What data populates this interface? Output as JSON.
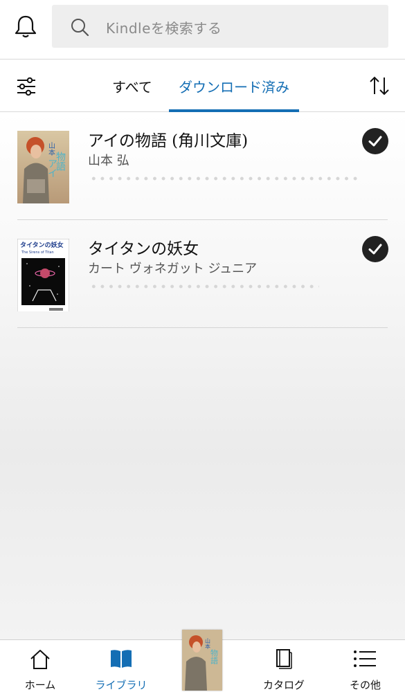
{
  "top_bar": {
    "bell_icon": "bell-icon",
    "search": {
      "placeholder": "Kindleを検索する",
      "icon": "search-icon"
    }
  },
  "filter_bar": {
    "filter_icon": "sliders-icon",
    "tabs": [
      {
        "label": "すべて",
        "active": false
      },
      {
        "label": "ダウンロード済み",
        "active": true
      }
    ],
    "sort_icon": "sort-arrows-icon",
    "accent_color": "#146eb4"
  },
  "books": [
    {
      "title": "アイの物語 (角川文庫)",
      "author": "山本 弘",
      "downloaded_icon": "checkmark-circle-icon",
      "cover": {
        "title_text": "アイの物語",
        "author_text": "山本弘"
      }
    },
    {
      "title": "タイタンの妖女",
      "author": "カート ヴォネガット ジュニア",
      "downloaded_icon": "checkmark-circle-icon",
      "cover": {
        "title_text": "タイタンの妖女",
        "subtitle_text": "The Sirens of Titan"
      }
    }
  ],
  "bottom_nav": {
    "items": [
      {
        "label": "ホーム",
        "icon": "home-icon",
        "active": false
      },
      {
        "label": "ライブラリ",
        "icon": "book-open-icon",
        "active": true
      },
      {
        "label": "カタログ",
        "icon": "catalog-icon",
        "active": false
      },
      {
        "label": "その他",
        "icon": "menu-list-icon",
        "active": false
      }
    ]
  }
}
